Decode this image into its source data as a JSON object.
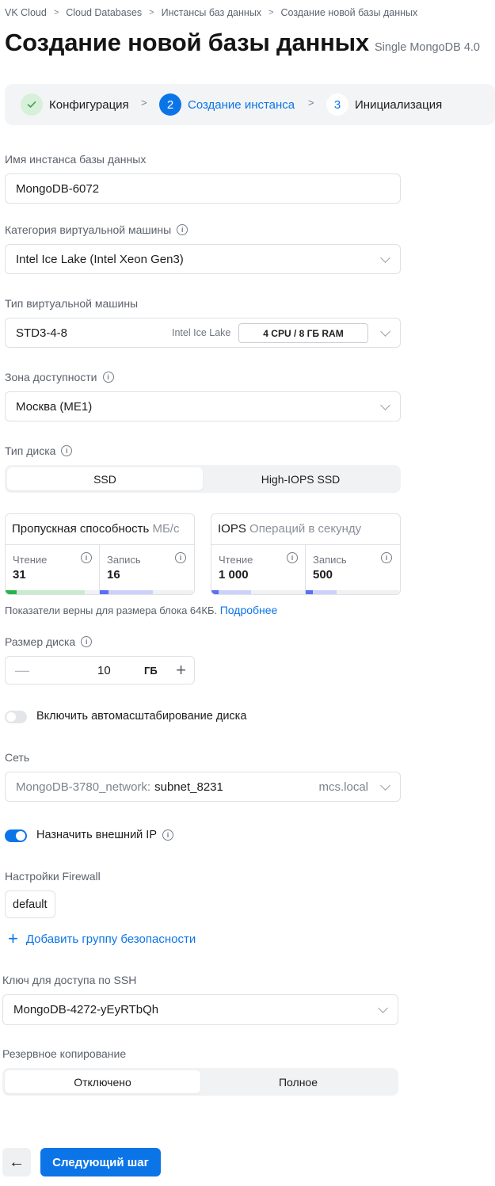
{
  "breadcrumb": [
    "VK Cloud",
    "Cloud Databases",
    "Инстансы баз данных",
    "Создание новой базы данных"
  ],
  "page": {
    "title": "Создание новой базы данных",
    "subtitle": "Single MongoDB 4.0"
  },
  "stepper": {
    "steps": [
      {
        "num": "✓",
        "label": "Конфигурация",
        "state": "done"
      },
      {
        "num": "2",
        "label": "Создание инстанса",
        "state": "active"
      },
      {
        "num": "3",
        "label": "Инициализация",
        "state": "todo"
      }
    ]
  },
  "form": {
    "instance_name": {
      "label": "Имя инстанса базы данных",
      "value": "MongoDB-6072"
    },
    "vm_category": {
      "label": "Категория виртуальной машины",
      "value": "Intel Ice Lake (Intel Xeon Gen3)"
    },
    "vm_type": {
      "label": "Тип виртуальной машины",
      "value": "STD3-4-8",
      "platform": "Intel Ice Lake",
      "spec": "4 CPU / 8 ГБ RAM"
    },
    "zone": {
      "label": "Зона доступности",
      "value": "Москва (ME1)"
    },
    "disk_type": {
      "label": "Тип диска",
      "options": [
        "SSD",
        "High-IOPS SSD"
      ],
      "selected": "SSD"
    },
    "throughput": {
      "title": "Пропускная способность",
      "unit": "МБ/с",
      "read_label": "Чтение",
      "read_value": "31",
      "read_fraction": 0.85,
      "write_label": "Запись",
      "write_value": "16",
      "write_fraction": 0.57
    },
    "iops": {
      "title": "IOPS",
      "unit": "Операций в секунду",
      "read_label": "Чтение",
      "read_value": "1 000",
      "read_fraction": 0.42,
      "write_label": "Запись",
      "write_value": "500",
      "write_fraction": 0.33
    },
    "note": {
      "text": "Показатели верны для размера блока 64КБ.",
      "link": "Подробнее"
    },
    "disk_size": {
      "label": "Размер диска",
      "value": "10",
      "unit": "ГБ",
      "minus": "—",
      "plus": "+"
    },
    "autoscale": {
      "label": "Включить автомасштабирование диска",
      "enabled": false
    },
    "network": {
      "label": "Сеть",
      "network": "MongoDB-3780_network:",
      "subnet": "subnet_8231",
      "domain": "mcs.local"
    },
    "external_ip": {
      "label": "Назначить внешний IP",
      "enabled": true
    },
    "firewall": {
      "label": "Настройки Firewall",
      "group": "default",
      "add_label": "Добавить группу безопасности"
    },
    "ssh_key": {
      "label": "Ключ для доступа по SSH",
      "value": "MongoDB-4272-yEyRTbQh"
    },
    "backup": {
      "label": "Резервное копирование",
      "options": [
        "Отключено",
        "Полное"
      ],
      "selected": "Отключено"
    }
  },
  "actions": {
    "back": "←",
    "next": "Следующий шаг"
  },
  "colors": {
    "accent": "#0b75e8",
    "read_fill": "#27b34c",
    "read_track": "#c7ebcf",
    "write_fill": "#5b6ff2",
    "write_track": "#ccd1fb"
  }
}
